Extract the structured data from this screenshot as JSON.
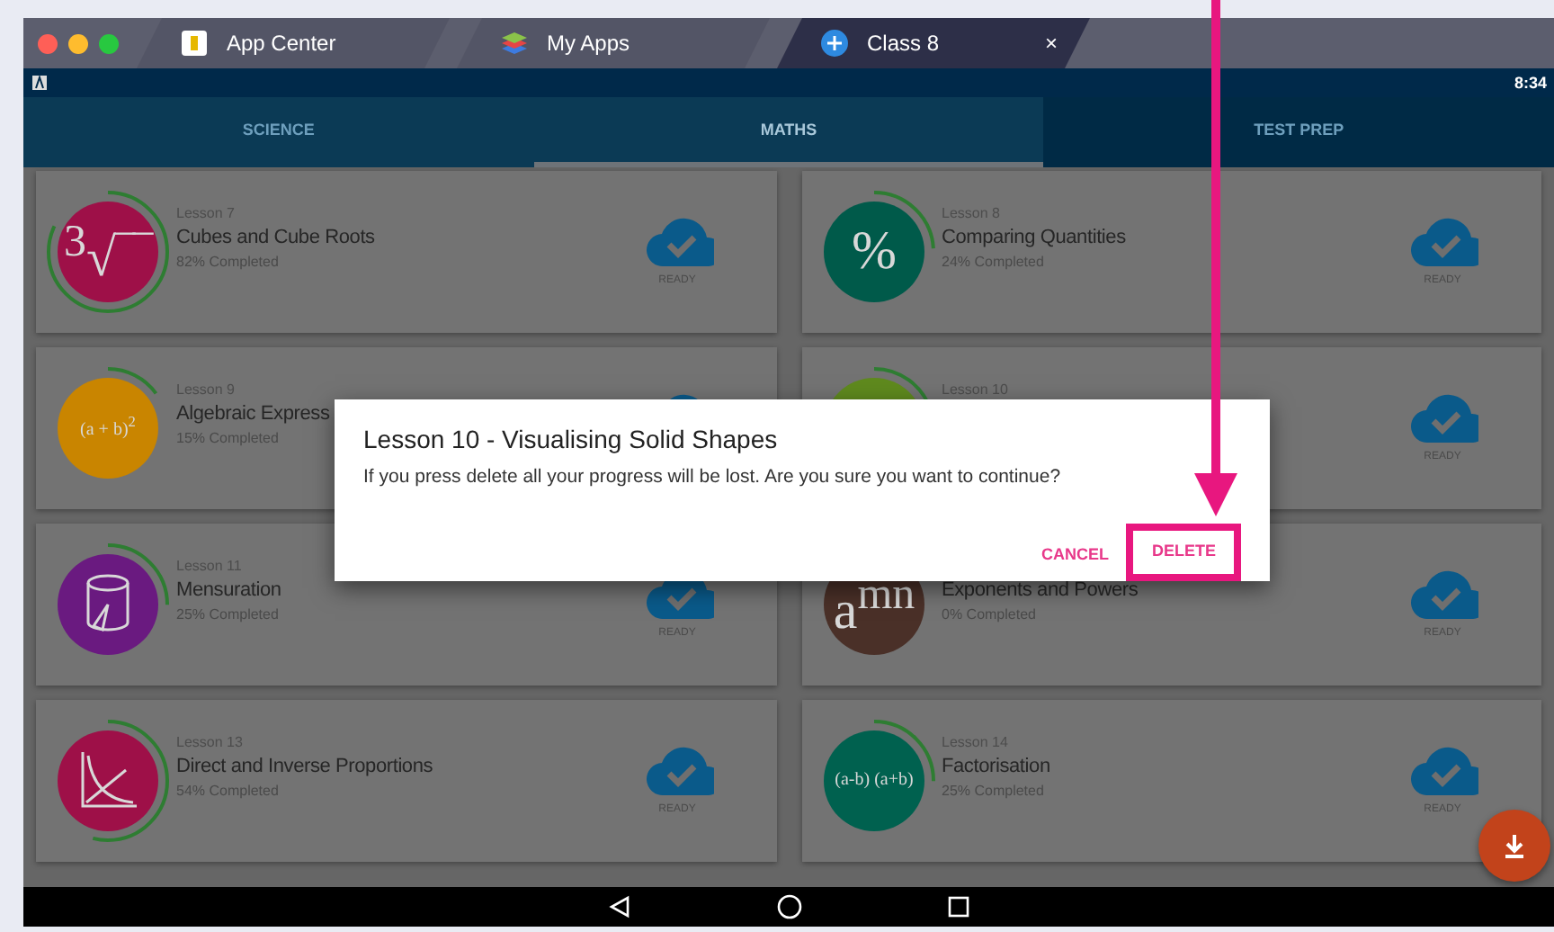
{
  "browser_tabs": [
    {
      "label": "App Center",
      "selected": false
    },
    {
      "label": "My Apps",
      "selected": false
    },
    {
      "label": "Class 8",
      "selected": true,
      "close": "×"
    }
  ],
  "status_bar": {
    "time": "8:34"
  },
  "tabs": [
    {
      "label": "SCIENCE",
      "selected": false
    },
    {
      "label": "MATHS",
      "selected": true
    },
    {
      "label": "TEST PREP",
      "selected": false
    }
  ],
  "lessons": [
    {
      "lesson": "Lesson 7",
      "title": "Cubes and Cube Roots",
      "progress": "82% Completed",
      "color": "#9e1048",
      "badge": {
        "kind": "text",
        "text": "$^{3}$√‾‾"
      },
      "ready": true,
      "status": "READY"
    },
    {
      "lesson": "Lesson 8",
      "title": "Comparing Quantities",
      "progress": "24% Completed",
      "color": "#005a4a",
      "badge": {
        "kind": "text",
        "text": "%"
      },
      "ready": true,
      "status": "READY"
    },
    {
      "lesson": "Lesson 9",
      "title": "Algebraic Express",
      "progress": "15% Completed",
      "color": "#c98500",
      "badge": {
        "kind": "text",
        "text": "(a + b)$^{2}$"
      },
      "ready": true
    },
    {
      "lesson": "Lesson 10",
      "color": "#5f8a1e",
      "badge": {
        "kind": "hidden"
      },
      "ready": true,
      "status": "READY"
    },
    {
      "lesson": "Lesson 11",
      "title": "Mensuration",
      "progress": "25% Completed",
      "color": "#6a1a80",
      "badge": {
        "kind": "cylinder"
      },
      "ready": true,
      "status": "READY"
    },
    {
      "title": "Exponents and Powers",
      "progress": "0% Completed",
      "color": "#4a3028",
      "badge": {
        "kind": "text",
        "text": "a$^{mn}$"
      },
      "ready": true,
      "status": "READY"
    },
    {
      "lesson": "Lesson 13",
      "title": "Direct and Inverse Proportions",
      "progress": "54% Completed",
      "color": "#9e1048",
      "badge": {
        "kind": "graph"
      },
      "ready": true,
      "status": "READY"
    },
    {
      "lesson": "Lesson 14",
      "title": "Factorisation",
      "progress": "25% Completed",
      "color": "#00614f",
      "badge": {
        "kind": "text",
        "text": "(a-b) (a+b)"
      },
      "ready": true,
      "status": "READY"
    }
  ],
  "dialog": {
    "title": "Lesson 10 - Visualising Solid Shapes",
    "message": "If you press delete all your progress will be lost. Are you sure you want to continue?",
    "buttons": [
      {
        "label": "CANCEL",
        "highlighted": false
      },
      {
        "label": "DELETE",
        "highlighted": true
      }
    ]
  }
}
